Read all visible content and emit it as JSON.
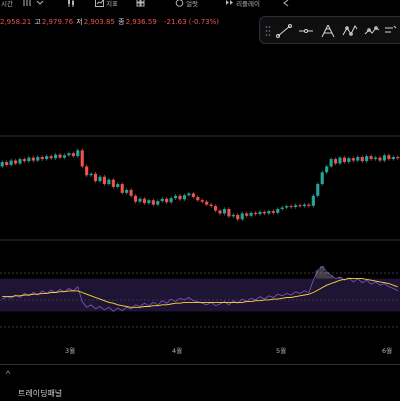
{
  "toolbar": {
    "interval_label": "시간",
    "indicators_label": "지표",
    "alert_label": "얼럿",
    "replay_label": "리플레이"
  },
  "ohlc": {
    "open_value": "2,958.21",
    "high_label": "고",
    "high_value": "2,979.76",
    "low_label": "저",
    "low_value": "2,903.85",
    "close_label": "종",
    "close_value": "2,936.59",
    "change": "-21.63 (-0.73%)"
  },
  "drawing_tools": [
    "trend-line-icon",
    "horizontal-line-icon",
    "pitchfork-icon",
    "pattern-icon",
    "path-icon",
    "text-icon"
  ],
  "x_axis": {
    "months": [
      "3월",
      "4월",
      "5월",
      "6월"
    ]
  },
  "bottom": {
    "trading_panel_label": "트레이딩패널"
  },
  "colors": {
    "up": "#26a69a",
    "down": "#ef5350",
    "rsi_line": "#7e57c2",
    "rsi_ma": "#fdd835",
    "rsi_band": "#1e1535"
  },
  "chart_data": {
    "type": "candlestick",
    "candles": [
      {
        "o": 2930,
        "c": 2945
      },
      {
        "o": 2945,
        "c": 2935
      },
      {
        "o": 2935,
        "c": 2950
      },
      {
        "o": 2950,
        "c": 2940
      },
      {
        "o": 2940,
        "c": 2955
      },
      {
        "o": 2955,
        "c": 2948
      },
      {
        "o": 2948,
        "c": 2960
      },
      {
        "o": 2960,
        "c": 2950
      },
      {
        "o": 2950,
        "c": 2962
      },
      {
        "o": 2962,
        "c": 2955
      },
      {
        "o": 2955,
        "c": 2965
      },
      {
        "o": 2965,
        "c": 2958
      },
      {
        "o": 2958,
        "c": 2970
      },
      {
        "o": 2970,
        "c": 2960
      },
      {
        "o": 2960,
        "c": 2968
      },
      {
        "o": 2968,
        "c": 2975
      },
      {
        "o": 2975,
        "c": 2965
      },
      {
        "o": 2965,
        "c": 2985
      },
      {
        "o": 2985,
        "c": 2930
      },
      {
        "o": 2930,
        "c": 2900
      },
      {
        "o": 2900,
        "c": 2905
      },
      {
        "o": 2905,
        "c": 2880
      },
      {
        "o": 2880,
        "c": 2895
      },
      {
        "o": 2895,
        "c": 2870
      },
      {
        "o": 2870,
        "c": 2885
      },
      {
        "o": 2885,
        "c": 2860
      },
      {
        "o": 2860,
        "c": 2870
      },
      {
        "o": 2870,
        "c": 2840
      },
      {
        "o": 2840,
        "c": 2850
      },
      {
        "o": 2850,
        "c": 2830
      },
      {
        "o": 2830,
        "c": 2810
      },
      {
        "o": 2810,
        "c": 2820
      },
      {
        "o": 2820,
        "c": 2805
      },
      {
        "o": 2805,
        "c": 2815
      },
      {
        "o": 2815,
        "c": 2800
      },
      {
        "o": 2800,
        "c": 2812
      },
      {
        "o": 2812,
        "c": 2820
      },
      {
        "o": 2820,
        "c": 2808
      },
      {
        "o": 2808,
        "c": 2822
      },
      {
        "o": 2822,
        "c": 2830
      },
      {
        "o": 2830,
        "c": 2818
      },
      {
        "o": 2818,
        "c": 2832
      },
      {
        "o": 2832,
        "c": 2838
      },
      {
        "o": 2838,
        "c": 2826
      },
      {
        "o": 2826,
        "c": 2815
      },
      {
        "o": 2815,
        "c": 2810
      },
      {
        "o": 2810,
        "c": 2800
      },
      {
        "o": 2800,
        "c": 2795
      },
      {
        "o": 2795,
        "c": 2780
      },
      {
        "o": 2780,
        "c": 2770
      },
      {
        "o": 2770,
        "c": 2785
      },
      {
        "o": 2785,
        "c": 2760
      },
      {
        "o": 2760,
        "c": 2765
      },
      {
        "o": 2765,
        "c": 2750
      },
      {
        "o": 2750,
        "c": 2770
      },
      {
        "o": 2770,
        "c": 2762
      },
      {
        "o": 2762,
        "c": 2772
      },
      {
        "o": 2772,
        "c": 2768
      },
      {
        "o": 2768,
        "c": 2775
      },
      {
        "o": 2775,
        "c": 2770
      },
      {
        "o": 2770,
        "c": 2778
      },
      {
        "o": 2778,
        "c": 2772
      },
      {
        "o": 2772,
        "c": 2785
      },
      {
        "o": 2785,
        "c": 2790
      },
      {
        "o": 2790,
        "c": 2795
      },
      {
        "o": 2795,
        "c": 2792
      },
      {
        "o": 2792,
        "c": 2798
      },
      {
        "o": 2798,
        "c": 2795
      },
      {
        "o": 2795,
        "c": 2800
      },
      {
        "o": 2800,
        "c": 2796
      },
      {
        "o": 2796,
        "c": 2830
      },
      {
        "o": 2830,
        "c": 2870
      },
      {
        "o": 2870,
        "c": 2910
      },
      {
        "o": 2910,
        "c": 2930
      },
      {
        "o": 2930,
        "c": 2955
      },
      {
        "o": 2955,
        "c": 2940
      },
      {
        "o": 2940,
        "c": 2960
      },
      {
        "o": 2960,
        "c": 2945
      },
      {
        "o": 2945,
        "c": 2958
      },
      {
        "o": 2958,
        "c": 2950
      },
      {
        "o": 2950,
        "c": 2962
      },
      {
        "o": 2962,
        "c": 2948
      },
      {
        "o": 2948,
        "c": 2965
      },
      {
        "o": 2965,
        "c": 2955
      },
      {
        "o": 2955,
        "c": 2960
      },
      {
        "o": 2960,
        "c": 2950
      },
      {
        "o": 2950,
        "c": 2968
      },
      {
        "o": 2968,
        "c": 2955
      },
      {
        "o": 2955,
        "c": 2962
      },
      {
        "o": 2962,
        "c": 2958
      }
    ],
    "rsi": [
      45,
      48,
      46,
      50,
      47,
      52,
      49,
      53,
      50,
      55,
      52,
      56,
      53,
      57,
      54,
      58,
      55,
      60,
      42,
      35,
      38,
      33,
      36,
      32,
      35,
      30,
      34,
      31,
      35,
      33,
      38,
      36,
      40,
      37,
      41,
      38,
      43,
      40,
      45,
      42,
      46,
      44,
      47,
      43,
      42,
      40,
      38,
      41,
      37,
      39,
      42,
      38,
      43,
      40,
      45,
      42,
      46,
      44,
      48,
      45,
      49,
      47,
      51,
      49,
      52,
      50,
      54,
      52,
      55,
      53,
      68,
      80,
      85,
      78,
      74,
      70,
      72,
      68,
      71,
      66,
      70,
      65,
      68,
      63,
      66,
      62,
      64,
      60,
      58,
      55
    ],
    "rsi_ma": [
      48,
      48,
      48,
      49,
      49,
      50,
      50,
      51,
      51,
      52,
      52,
      53,
      53,
      54,
      54,
      55,
      55,
      55,
      53,
      51,
      49,
      47,
      45,
      43,
      41,
      40,
      38,
      37,
      36,
      35,
      35,
      35,
      36,
      36,
      37,
      37,
      38,
      38,
      39,
      40,
      40,
      41,
      41,
      41,
      41,
      41,
      41,
      41,
      41,
      41,
      41,
      41,
      41,
      41,
      41,
      42,
      42,
      43,
      43,
      44,
      44,
      45,
      45,
      46,
      47,
      47,
      48,
      49,
      50,
      51,
      53,
      56,
      59,
      62,
      64,
      66,
      68,
      69,
      70,
      70,
      70,
      70,
      69,
      68,
      67,
      66,
      65,
      64,
      62,
      60
    ],
    "rsi_band": [
      30,
      70
    ],
    "price_range": [
      2700,
      3020
    ]
  }
}
